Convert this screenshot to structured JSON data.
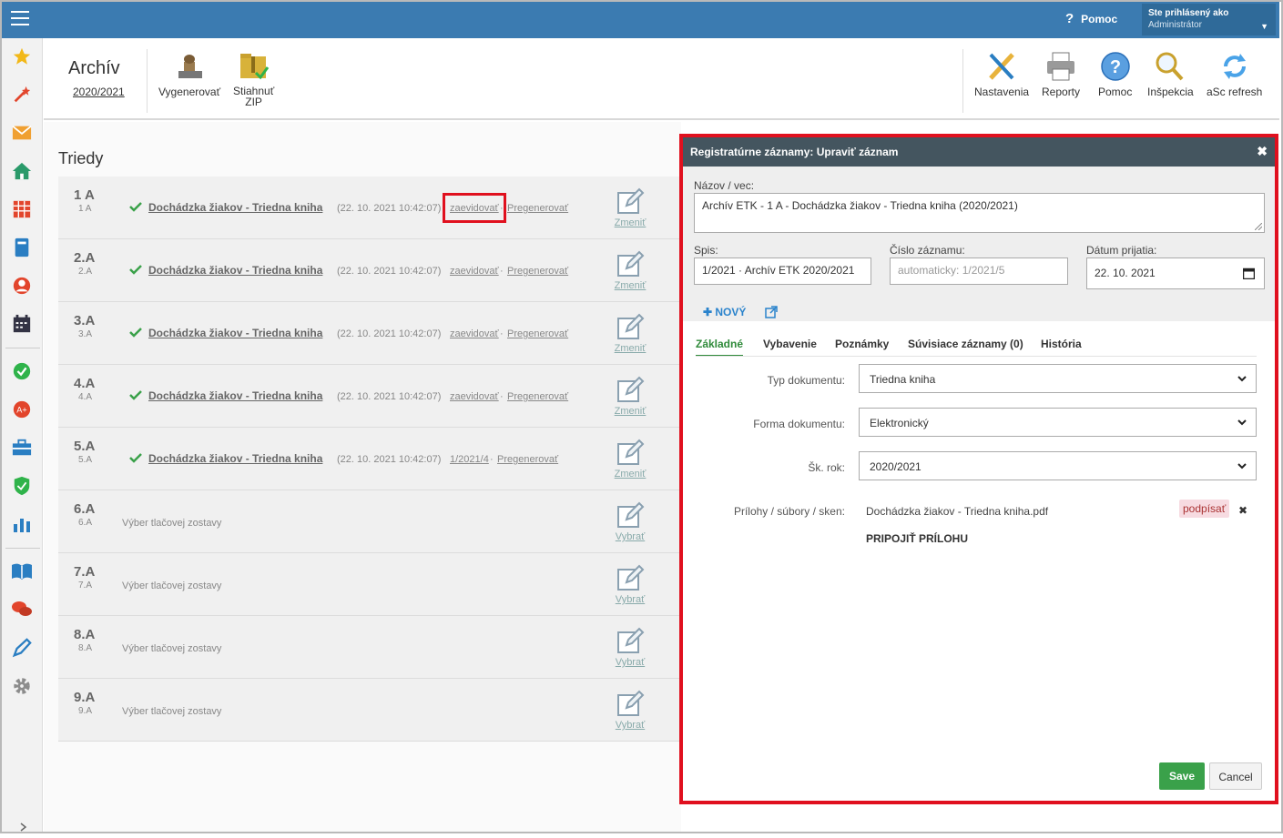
{
  "topbar": {
    "help_label": "Pomoc",
    "user_line1": "Ste prihlásený ako",
    "user_line2": "Administrátor"
  },
  "toolbar": {
    "title": "Archív",
    "year": "2020/2021",
    "left_buttons": [
      {
        "label": "Vygenerovať"
      },
      {
        "label_line1": "Stiahnuť",
        "label_line2": "ZIP"
      }
    ],
    "right_buttons": [
      {
        "label": "Nastavenia"
      },
      {
        "label": "Reporty"
      },
      {
        "label": "Pomoc"
      },
      {
        "label": "Inšpekcia"
      },
      {
        "label": "aSc refresh"
      }
    ]
  },
  "main": {
    "heading": "Triedy",
    "rows": [
      {
        "cls": "1 A",
        "sub": "1 A",
        "doc": "Dochádzka žiakov - Triedna kniha",
        "ts": "(22. 10. 2021 10:42:07)",
        "act1": "zaevidovať",
        "act2": "Pregenerovať",
        "edit": "Zmeniť"
      },
      {
        "cls": "2.A",
        "sub": "2.A",
        "doc": "Dochádzka žiakov - Triedna kniha",
        "ts": "(22. 10. 2021 10:42:07)",
        "act1": "zaevidovať",
        "act2": "Pregenerovať",
        "edit": "Zmeniť"
      },
      {
        "cls": "3.A",
        "sub": "3.A",
        "doc": "Dochádzka žiakov - Triedna kniha",
        "ts": "(22. 10. 2021 10:42:07)",
        "act1": "zaevidovať",
        "act2": "Pregenerovať",
        "edit": "Zmeniť"
      },
      {
        "cls": "4.A",
        "sub": "4.A",
        "doc": "Dochádzka žiakov - Triedna kniha",
        "ts": "(22. 10. 2021 10:42:07)",
        "act1": "zaevidovať",
        "act2": "Pregenerovať",
        "edit": "Zmeniť"
      },
      {
        "cls": "5.A",
        "sub": "5.A",
        "doc": "Dochádzka žiakov - Triedna kniha",
        "ts": "(22. 10. 2021 10:42:07)",
        "act1": "1/2021/4",
        "act2": "Pregenerovať",
        "edit": "Zmeniť"
      },
      {
        "cls": "6.A",
        "sub": "6.A",
        "vyber": "Výber tlačovej zostavy",
        "edit": "Vybrať"
      },
      {
        "cls": "7.A",
        "sub": "7.A",
        "vyber": "Výber tlačovej zostavy",
        "edit": "Vybrať"
      },
      {
        "cls": "8.A",
        "sub": "8.A",
        "vyber": "Výber tlačovej zostavy",
        "edit": "Vybrať"
      },
      {
        "cls": "9.A",
        "sub": "9.A",
        "vyber": "Výber tlačovej zostavy",
        "edit": "Vybrať"
      }
    ]
  },
  "dialog": {
    "title": "Registratúrne záznamy: Upraviť záznam",
    "nazov_label": "Názov / vec:",
    "nazov_value": "Archív ETK - 1 A - Dochádzka žiakov - Triedna kniha (2020/2021)",
    "spis_label": "Spis:",
    "spis_value": "1/2021 · Archív ETK 2020/2021",
    "cislo_label": "Číslo záznamu:",
    "cislo_placeholder": "automaticky: 1/2021/5",
    "datum_label": "Dátum prijatia:",
    "datum_value": "22. 10. 2021",
    "novy_label": "NOVÝ",
    "tabs": [
      "Základné",
      "Vybavenie",
      "Poznámky",
      "Súvisiace záznamy (0)",
      "História"
    ],
    "typ_label": "Typ dokumentu:",
    "typ_value": "Triedna kniha",
    "forma_label": "Forma dokumentu:",
    "forma_value": "Elektronický",
    "rok_label": "Šk. rok:",
    "rok_value": "2020/2021",
    "prilohy_label": "Prílohy / súbory / sken:",
    "file_name": "Dochádzka žiakov - Triedna kniha.pdf",
    "podpisat": "podpísať",
    "pripojit": "PRIPOJIŤ PRÍLOHU",
    "save": "Save",
    "cancel": "Cancel"
  },
  "colors": {
    "topbar": "#3b7bb1",
    "dialog_head": "#44555f",
    "highlight": "#e0101e",
    "save": "#3aa14a",
    "active_tab": "#2f8a3a"
  }
}
